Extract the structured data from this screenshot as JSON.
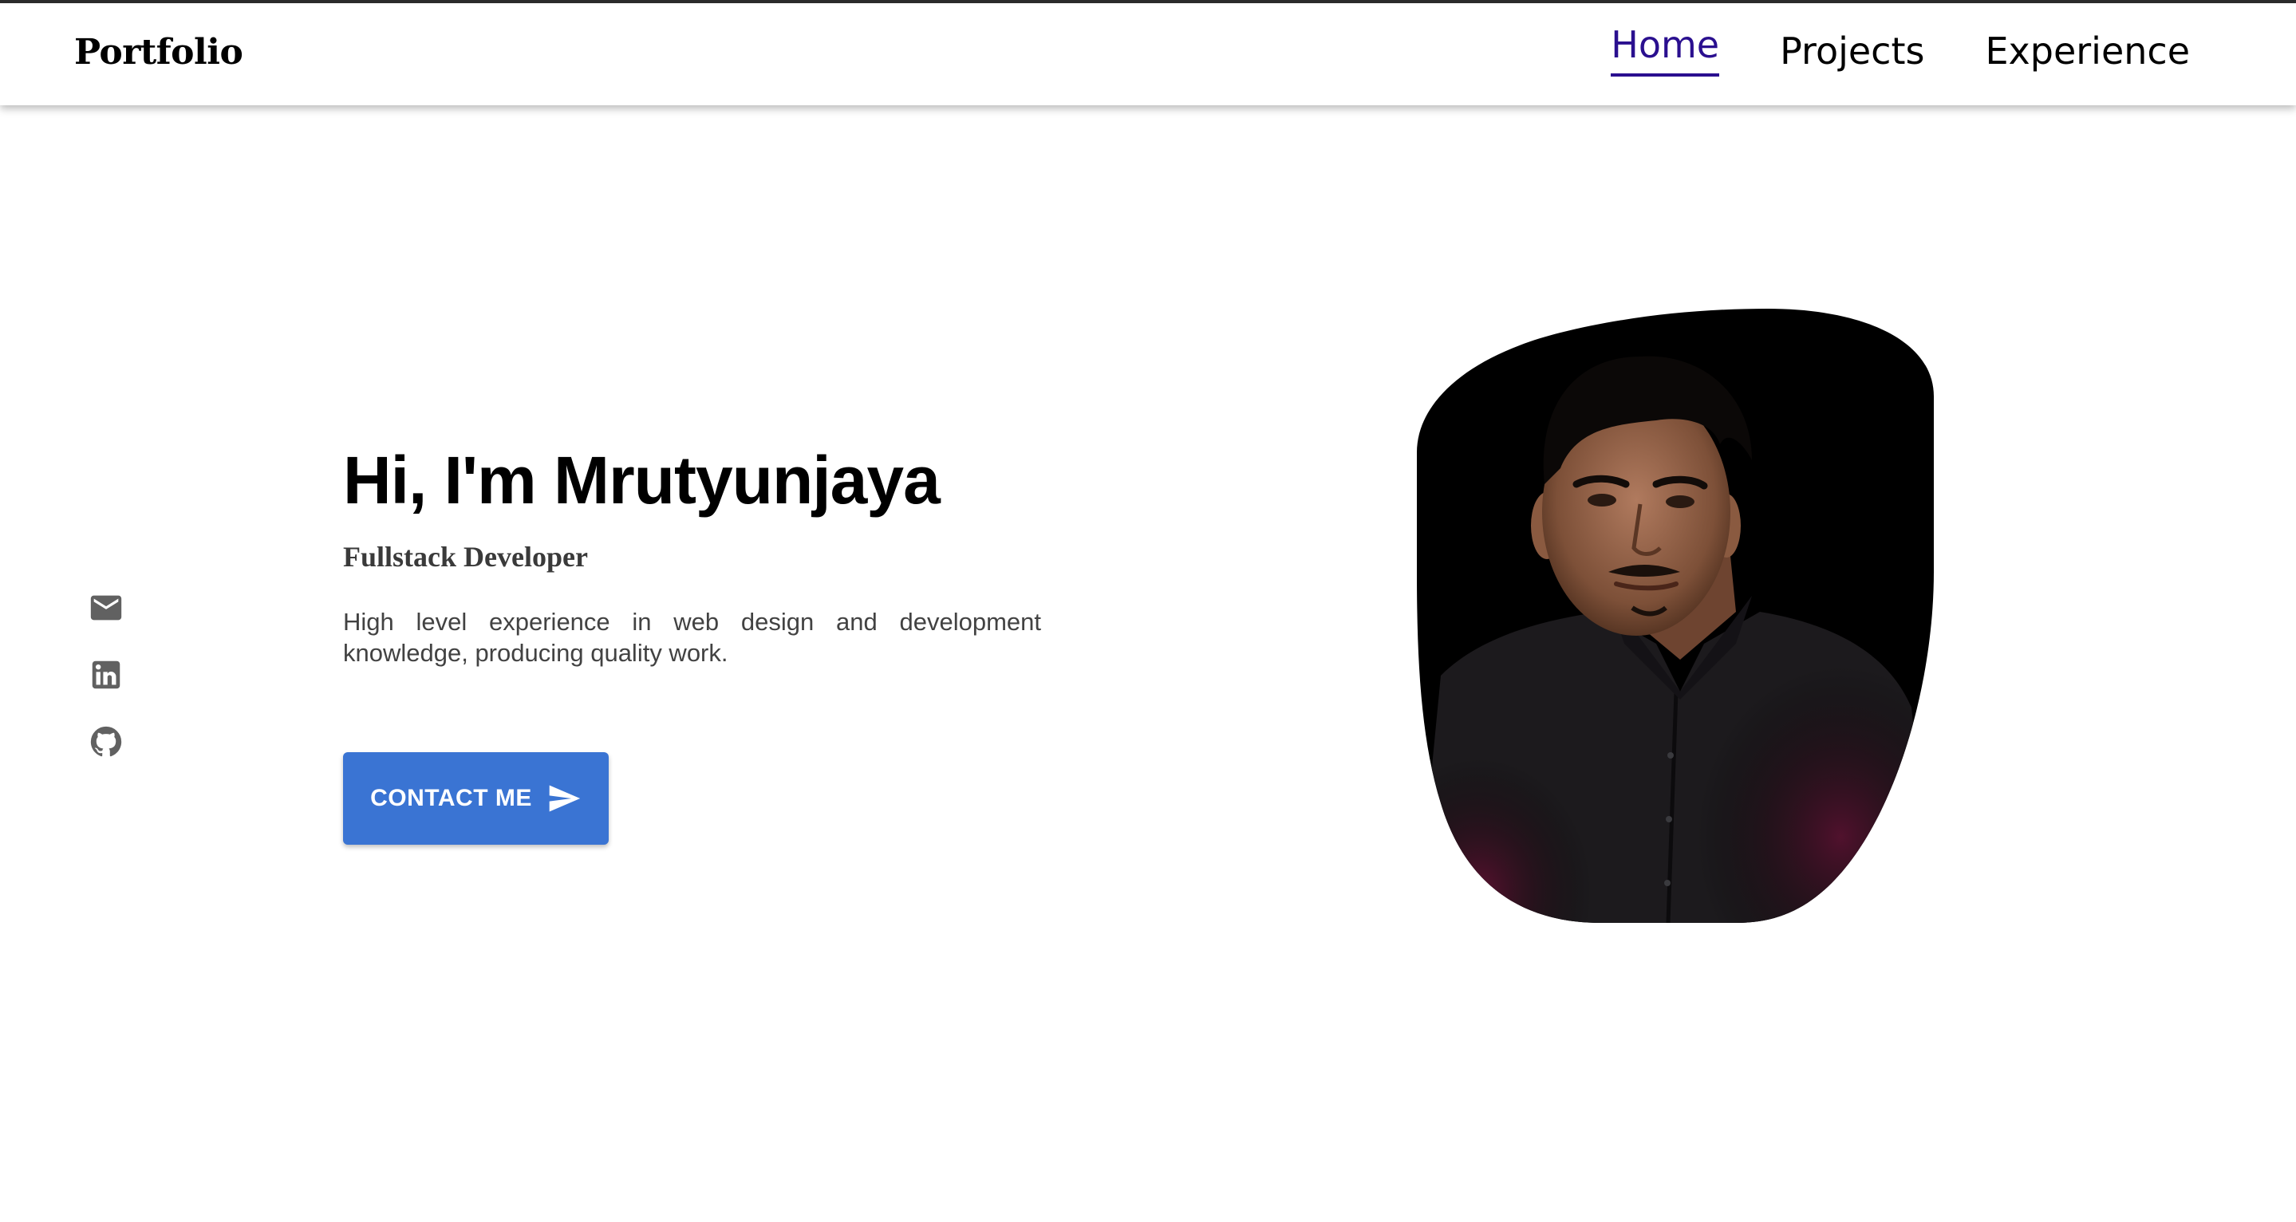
{
  "header": {
    "brand": "Portfolio",
    "nav": [
      {
        "label": "Home",
        "active": true
      },
      {
        "label": "Projects",
        "active": false
      },
      {
        "label": "Experience",
        "active": false
      }
    ],
    "active_color": "#2a0f8f"
  },
  "social": [
    {
      "icon": "email-icon"
    },
    {
      "icon": "linkedin-icon"
    },
    {
      "icon": "github-icon"
    }
  ],
  "hero": {
    "title": "Hi, I'm Mrutyunjaya",
    "subtitle": "Fullstack Developer",
    "description": "High level experience in web design and development knowledge, producing quality work.",
    "cta_label": "CONTACT ME",
    "cta_icon": "send-icon",
    "cta_color": "#3a74d3"
  },
  "portrait": {
    "icon": "profile-photo"
  }
}
